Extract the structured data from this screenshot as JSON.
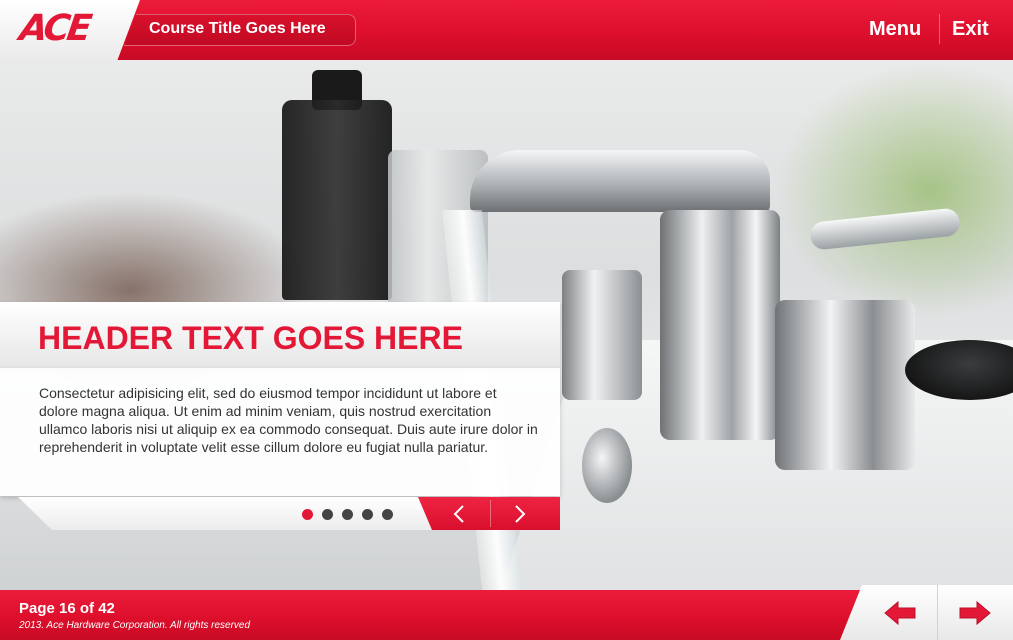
{
  "header": {
    "logo_text": "ACE",
    "course_title": "Course Title Goes Here",
    "menu_label": "Menu",
    "exit_label": "Exit"
  },
  "content": {
    "heading": "HEADER TEXT GOES HERE",
    "body": "Consectetur adipisicing elit, sed do eiusmod tempor incididunt ut labore et dolore magna aliqua. Ut enim ad minim veniam, quis nostrud exercitation ullamco laboris nisi ut aliquip ex ea commodo consequat. Duis aute irure dolor in reprehenderit in voluptate velit esse cillum dolore eu fugiat nulla pariatur.",
    "slides_total": 5,
    "slide_current": 1
  },
  "footer": {
    "page_label": "Page 16 of 42",
    "copyright": "2013. Ace Hardware Corporation. All rights reserved"
  },
  "colors": {
    "brand_red": "#e31837",
    "dark_dot": "#444444"
  },
  "icons": {
    "slide_prev": "chevron-left-icon",
    "slide_next": "chevron-right-icon",
    "page_prev": "arrow-left-icon",
    "page_next": "arrow-right-icon"
  }
}
